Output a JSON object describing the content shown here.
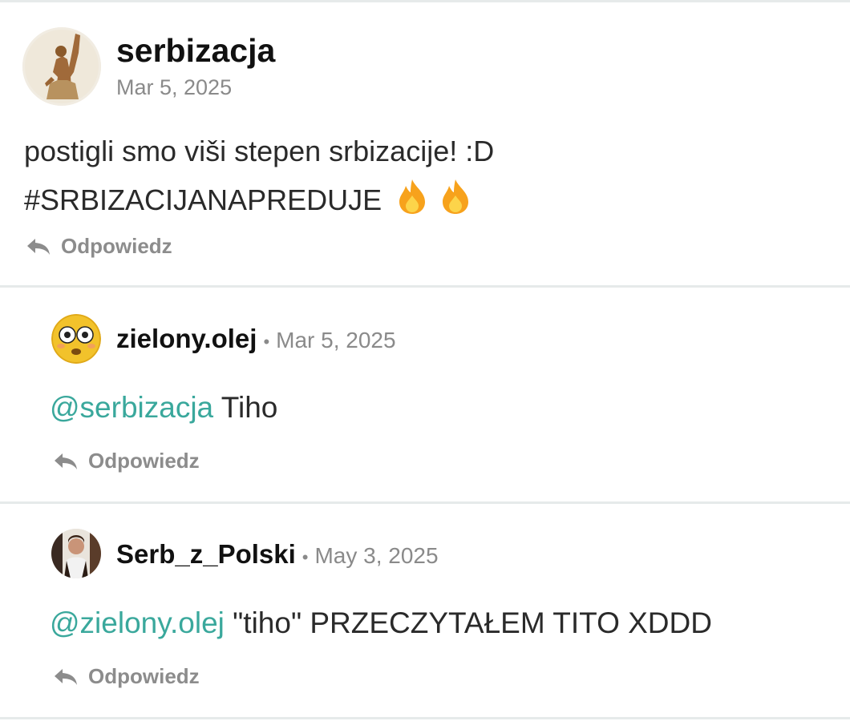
{
  "colors": {
    "mention": "#3aa89c",
    "divider": "#e6eaea",
    "meta": "#8a8a8a",
    "reply": "#8c8c8c"
  },
  "post": {
    "username": "serbizacja",
    "date": "Mar 5, 2025",
    "line1": "postigli smo viši stepen srbizacije! :D",
    "line2": "#SRBIZACIJANAPREDUJE",
    "emoji": [
      "fire-icon",
      "fire-icon"
    ],
    "reply_label": "Odpowiedz",
    "avatar_icon": "statue-avatar"
  },
  "comments": [
    {
      "username": "zielony.olej",
      "separator": "•",
      "date": "Mar 5, 2025",
      "mention": "@serbizacja",
      "text": " Tiho",
      "reply_label": "Odpowiedz",
      "avatar_icon": "flushed-face-avatar"
    },
    {
      "username": "Serb_z_Polski",
      "separator": "•",
      "date": "May 3, 2025",
      "mention": "@zielony.olej",
      "text": " \"tiho\" PRZECZYTAŁEM TITO XDDD",
      "reply_label": "Odpowiedz",
      "avatar_icon": "person-photo-avatar"
    }
  ]
}
